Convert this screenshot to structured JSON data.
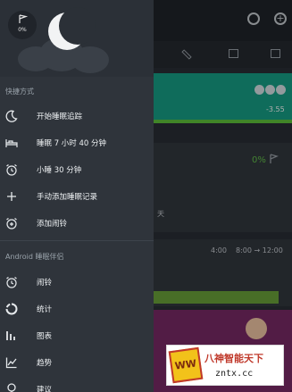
{
  "background": {
    "progress_label": "-3.55",
    "card_percent": "0%",
    "day_label": "天",
    "time_start": "4:00",
    "time_range": "8:00 → 12:00"
  },
  "drawer": {
    "badge_percent": "0%",
    "shortcuts_title": "快捷方式",
    "shortcuts": [
      {
        "label": "开始睡眠追踪",
        "icon": "moon-icon"
      },
      {
        "label": "睡眠 7 小时 40 分钟",
        "icon": "bed-icon"
      },
      {
        "label": "小睡 30 分钟",
        "icon": "alarm-clock-icon"
      },
      {
        "label": "手动添加睡眠记录",
        "icon": "plus-icon"
      },
      {
        "label": "添加闹铃",
        "icon": "add-alarm-icon"
      }
    ],
    "companion_title": "Android 睡眠伴侣",
    "companion": [
      {
        "label": "闹铃",
        "icon": "alarm-icon"
      },
      {
        "label": "统计",
        "icon": "stats-ring-icon"
      },
      {
        "label": "图表",
        "icon": "bar-chart-icon"
      },
      {
        "label": "趋势",
        "icon": "trend-icon"
      },
      {
        "label": "建议",
        "icon": "bulb-icon"
      }
    ]
  },
  "watermark": {
    "logo_text": "WW",
    "title": "八神智能天下",
    "url": "zntx.cc"
  },
  "colors": {
    "drawer_bg": "#2f343b",
    "accent_green": "#17a087",
    "bar_green": "#6aa33a",
    "purple": "#7a2a66"
  }
}
